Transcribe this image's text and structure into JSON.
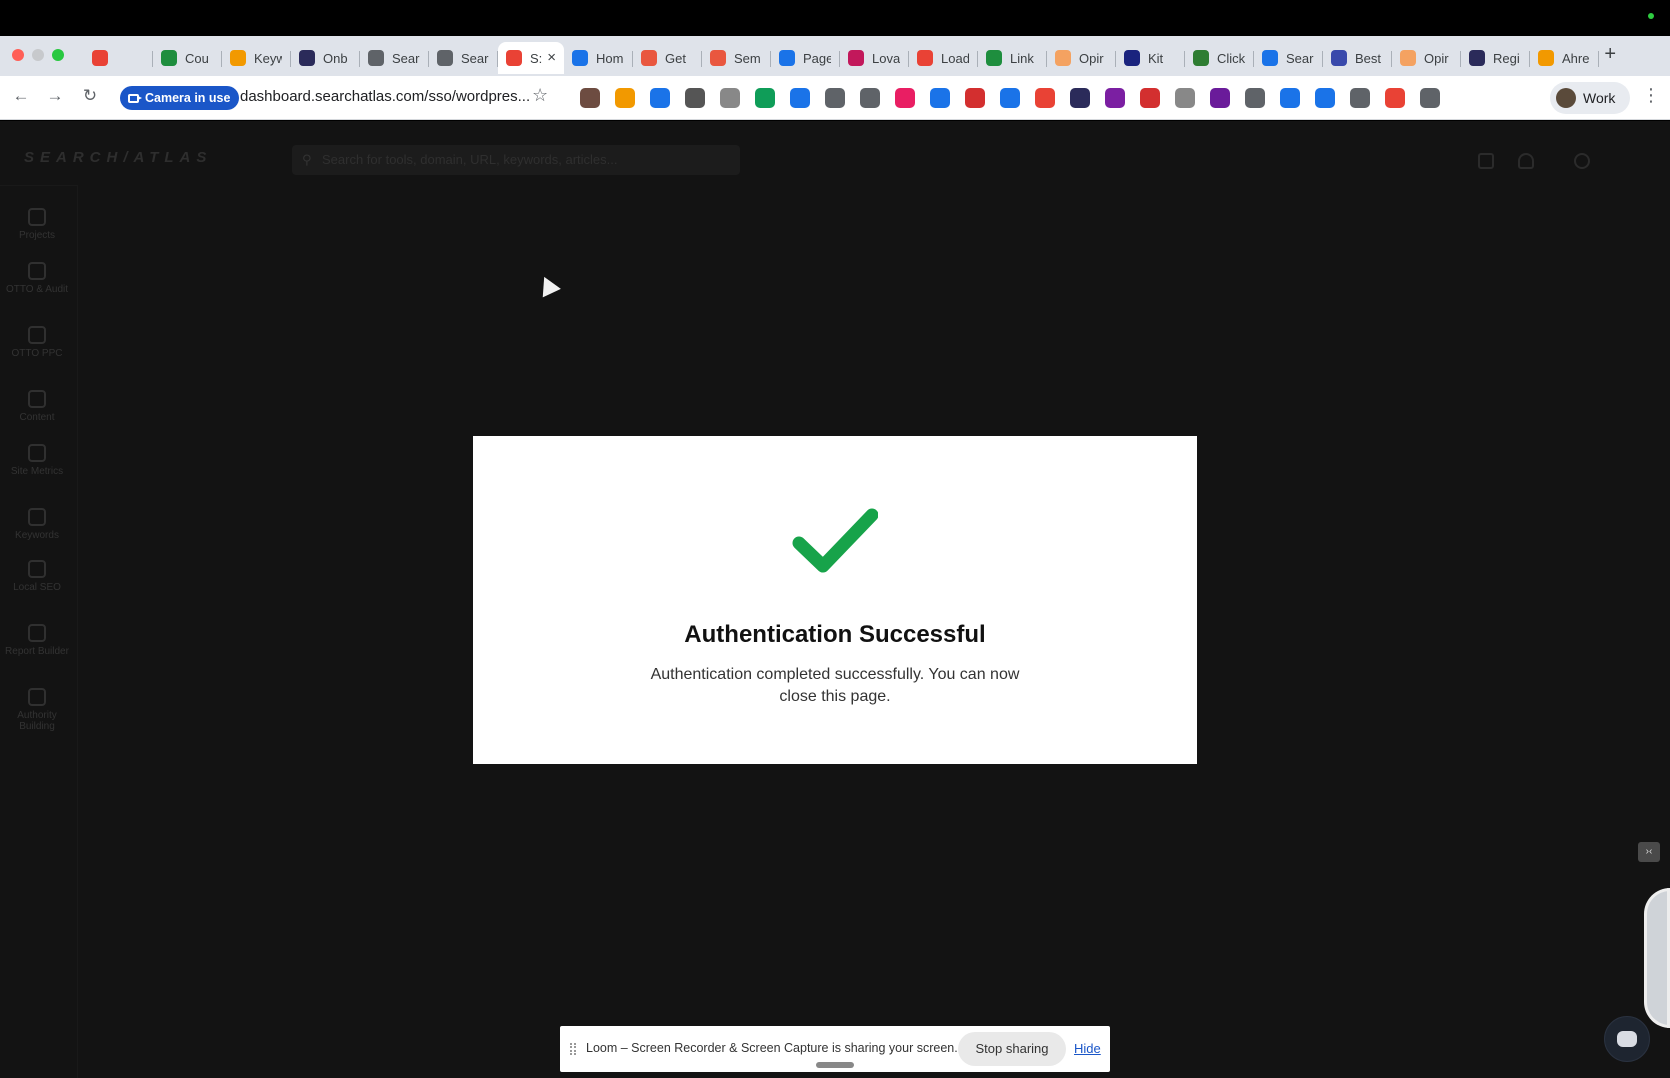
{
  "browser": {
    "tabs": [
      {
        "label": "",
        "color": "#e94235"
      },
      {
        "label": "Cou",
        "color": "#1e8e3e"
      },
      {
        "label": "Keyw",
        "color": "#f29900"
      },
      {
        "label": "Onb",
        "color": "#2b2b5a"
      },
      {
        "label": "Sear",
        "color": "#5f6368"
      },
      {
        "label": "Sear",
        "color": "#5f6368"
      },
      {
        "label": "S:",
        "color": "#e94235",
        "active": true
      },
      {
        "label": "Hom",
        "color": "#1a73e8"
      },
      {
        "label": "Get",
        "color": "#e9573f"
      },
      {
        "label": "Sem",
        "color": "#e9573f"
      },
      {
        "label": "Page",
        "color": "#1a73e8"
      },
      {
        "label": "Lova",
        "color": "#c2185b"
      },
      {
        "label": "Load",
        "color": "#e94235"
      },
      {
        "label": "Link",
        "color": "#1e8e3e"
      },
      {
        "label": "Opir",
        "color": "#f4a261"
      },
      {
        "label": "Kit",
        "color": "#1a237e"
      },
      {
        "label": "Click",
        "color": "#2e7d32"
      },
      {
        "label": "Sear",
        "color": "#1a73e8"
      },
      {
        "label": "Best",
        "color": "#3949ab"
      },
      {
        "label": "Opir",
        "color": "#f4a261"
      },
      {
        "label": "Regi",
        "color": "#2b2b5a"
      },
      {
        "label": "Ahre",
        "color": "#f29900"
      }
    ],
    "new_tab": "+",
    "camera_label": "Camera in use",
    "url": "dashboard.searchatlas.com/sso/wordpres...",
    "profile_label": "Work",
    "extension_colors": [
      "#6d4c41",
      "#f29900",
      "#1a73e8",
      "#555",
      "#888",
      "#0f9d58",
      "#1a73e8",
      "#5f6368",
      "#5f6368",
      "#e91e63",
      "#1a73e8",
      "#d32f2f",
      "#1a73e8",
      "#e94235",
      "#2b2b5a",
      "#7b1fa2",
      "#d32f2f",
      "#888",
      "#6a1b9a",
      "#5f6368",
      "#1a73e8",
      "#1a73e8",
      "#5f6368",
      "#e94235",
      "#5f6368"
    ]
  },
  "app": {
    "logo": "SEARCH/ATLAS",
    "search_placeholder": "Search for tools, domain, URL, keywords, articles...",
    "sidebar": [
      {
        "label": "Projects"
      },
      {
        "label": "OTTO & Audit"
      },
      {
        "label": "OTTO PPC"
      },
      {
        "label": "Content"
      },
      {
        "label": "Site Metrics"
      },
      {
        "label": "Keywords"
      },
      {
        "label": "Local SEO"
      },
      {
        "label": "Report Builder"
      },
      {
        "label": "Authority Building"
      }
    ]
  },
  "modal": {
    "title": "Authentication Successful",
    "message": "Authentication completed successfully. You can now close this page.",
    "check_color": "#17a34a"
  },
  "loom": {
    "message": "Loom – Screen Recorder & Screen Capture is sharing your screen.",
    "stop_label": "Stop sharing",
    "hide_label": "Hide"
  }
}
